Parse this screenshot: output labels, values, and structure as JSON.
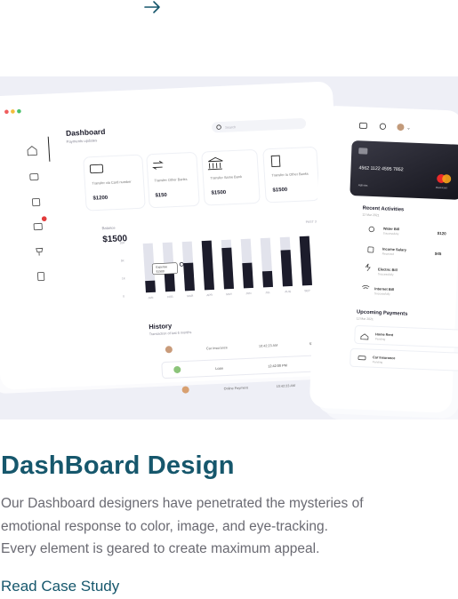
{
  "card": {
    "title": "DashBoard Design",
    "description_lines": [
      "Our Dashboard designers have penetrated the mysteries of",
      "emotional response to color, image,  and eye-tracking.",
      "Every element is geared to create maximum appeal."
    ],
    "cta": "Read Case Study",
    "arrow_icon": "arrow-right-icon",
    "colors": {
      "accent": "#16576c",
      "text": "#6a6a72",
      "hero_bg": "#eeeff6"
    }
  },
  "mockup": {
    "dashboard": {
      "title": "Dashboard",
      "subtitle": "Payments updates",
      "search_placeholder": "Search",
      "tiles": [
        {
          "label": "Transfer via Card number",
          "amount": "$1200",
          "icon": "card-icon"
        },
        {
          "label": "Transfer Other Banks",
          "amount": "$150",
          "icon": "transfer-icon"
        },
        {
          "label": "Transfer Same Bank",
          "amount": "$1500",
          "icon": "bank-icon"
        },
        {
          "label": "Transfer to Other Banks",
          "amount": "$1500",
          "icon": "building-icon"
        }
      ],
      "balance_label": "Balance",
      "balance_value": "$1500",
      "period_label": "PAST 30 DAYS",
      "tooltip": {
        "label": "Expense",
        "value": "$1500"
      },
      "history_title": "History",
      "history_subtitle": "Transaction of last 6 months",
      "history_rows": [
        {
          "name": "Car Insurance",
          "time": "10:42:23 AM",
          "amount": "$350.00",
          "status": "Completed"
        },
        {
          "name": "Loan",
          "time": "12:42:00 PM",
          "amount": "$5500.00",
          "status": "Completed"
        },
        {
          "name": "Online Payment",
          "time": "10:42:23 AM",
          "amount": "$154.00",
          "status": "Completed"
        }
      ]
    },
    "wallet": {
      "card_number": "4562 1122 4595 7852",
      "card_brand": "Mastercard",
      "card_holder": "Ashvira",
      "recent_title": "Recent Activities",
      "recent_date": "12 Mar 2021",
      "activities": [
        {
          "name": "Water Bill",
          "status": "Successfully",
          "amount": "$120",
          "icon": "water-icon"
        },
        {
          "name": "Income Salary",
          "status": "Received",
          "amount": "$45",
          "icon": "salary-icon"
        },
        {
          "name": "Electric Bill",
          "status": "Successfully",
          "amount": "",
          "icon": "electric-icon"
        },
        {
          "name": "Internet Bill",
          "status": "Successfully",
          "amount": "",
          "icon": "wifi-icon"
        }
      ],
      "upcoming_title": "Upcoming Payments",
      "upcoming_date": "12 Mar 2021",
      "upcoming": [
        {
          "name": "Home Rent",
          "status": "Pending",
          "icon": "home-icon"
        },
        {
          "name": "Car Insurance",
          "status": "Pending",
          "icon": "car-icon"
        }
      ]
    },
    "chart_data": {
      "type": "bar",
      "categories": [
        "JAN",
        "FEB",
        "MAR",
        "APR",
        "MAY",
        "JUN",
        "JUL",
        "AUG",
        "SEP",
        "OCT",
        "NOV"
      ],
      "series": [
        {
          "values": [
            0.22,
            0.38,
            0.52,
            0.92,
            0.77,
            0.47,
            0.3,
            0.68,
            0.92,
            0.6,
            0.45
          ]
        }
      ],
      "background_values": [
        0.92,
        0.92,
        0.92,
        0.92,
        0.92,
        0.92,
        0.92,
        0.92,
        0.92,
        0.92,
        0.92
      ],
      "ytick_labels": [
        "10K",
        "5K",
        "1K",
        "0"
      ],
      "colors": {
        "bar": "#1c1c2b",
        "bar_bg": "#e2e3ec"
      }
    }
  }
}
